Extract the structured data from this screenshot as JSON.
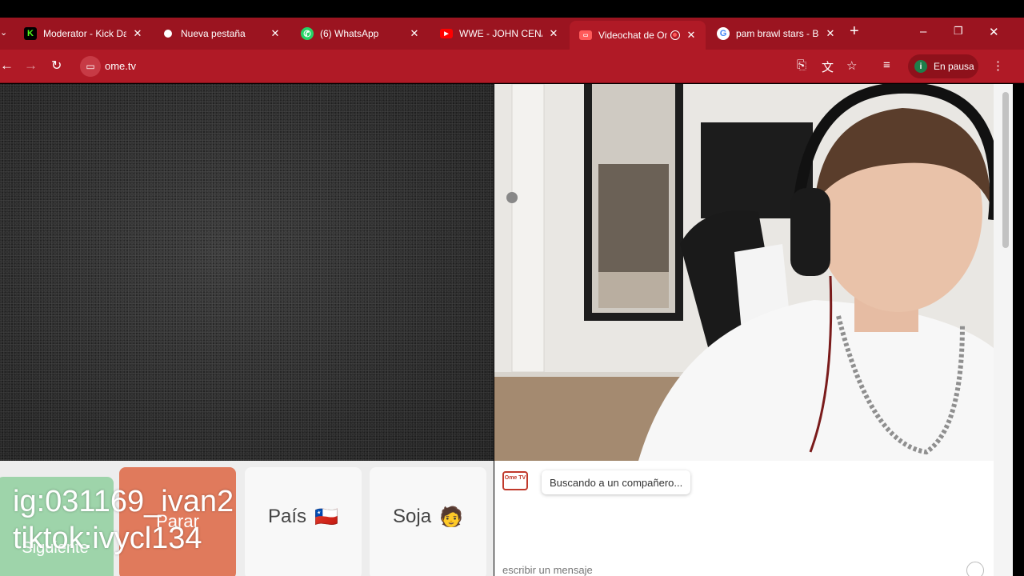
{
  "browser": {
    "tabs": [
      {
        "title": "Moderator - Kick Das",
        "favicon": "kick-icon",
        "color": "#53fc18"
      },
      {
        "title": "Nueva pestaña",
        "favicon": "chrome-icon",
        "color": "#ffffff"
      },
      {
        "title": "(6) WhatsApp",
        "favicon": "whatsapp-icon",
        "color": "#25d366"
      },
      {
        "title": "WWE - JOHN CENA E",
        "favicon": "youtube-icon",
        "color": "#ff0000"
      },
      {
        "title": "Videochat de Om",
        "favicon": "ometv-icon",
        "color": "#ff5a5a",
        "active": true
      },
      {
        "title": "pam brawl stars - Bus",
        "favicon": "google-icon",
        "color": "#4285f4"
      }
    ],
    "new_tab": "+",
    "window_controls": {
      "minimize": "–",
      "restore": "❐",
      "close": "✕"
    },
    "toolbar": {
      "url": "ome.tv",
      "profile_status": "En pausa",
      "profile_initial": "i"
    },
    "accent_color": "#b01a26"
  },
  "controls": {
    "next_label": "Siguiente",
    "stop_label": "Parar",
    "country_label": "País",
    "country_flag": "🇨🇱",
    "gender_label": "Soja",
    "gender_emoji": "🧑"
  },
  "chat": {
    "logo_text": "Ome TV",
    "status_message": "Buscando a un compañero...",
    "input_placeholder": "escribir un mensaje"
  },
  "overlay": {
    "line1": "ig:031169_ivan2",
    "line2": "tiktok:ivycl134"
  }
}
